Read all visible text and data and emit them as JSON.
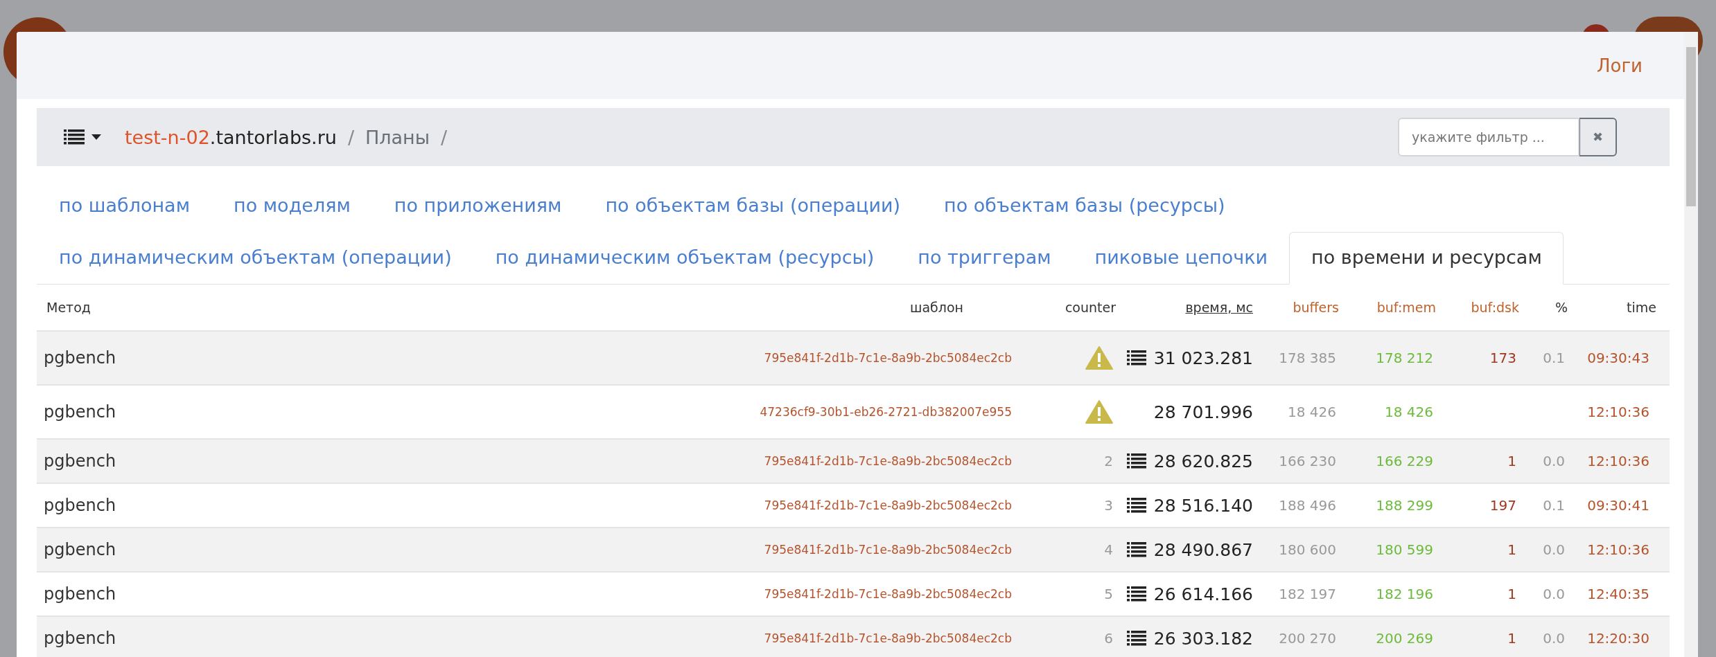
{
  "header": {
    "link": "Логи"
  },
  "breadcrumb": {
    "host_highlight": "test-n-02",
    "host_rest": ".tantorlabs.ru",
    "separator_1": "/",
    "section": "Планы",
    "separator_2": "/"
  },
  "filter": {
    "placeholder": "укажите фильтр ...",
    "clear": "✖"
  },
  "tabs": [
    [
      {
        "label": "по шаблонам",
        "selected": false
      },
      {
        "label": "по моделям",
        "selected": false
      },
      {
        "label": "по приложениям",
        "selected": false
      },
      {
        "label": "по объектам базы (операции)",
        "selected": false
      },
      {
        "label": "по объектам базы (ресурсы)",
        "selected": false
      }
    ],
    [
      {
        "label": "по динамическим объектам (операции)",
        "selected": false
      },
      {
        "label": "по динамическим объектам (ресурсы)",
        "selected": false
      },
      {
        "label": "по триггерам",
        "selected": false
      },
      {
        "label": "пиковые цепочки",
        "selected": false
      },
      {
        "label": "по времени и ресурсам",
        "selected": true
      }
    ]
  ],
  "table": {
    "columns": [
      {
        "label": "Метод",
        "kind": "plain"
      },
      {
        "label": "шаблон",
        "kind": "plain"
      },
      {
        "label": "counter",
        "kind": "plain"
      },
      {
        "label": "время, мс",
        "kind": "sort"
      },
      {
        "label": "buffers",
        "kind": "accent"
      },
      {
        "label": "buf:mem",
        "kind": "accent"
      },
      {
        "label": "buf:dsk",
        "kind": "accent"
      },
      {
        "label": "%",
        "kind": "plain"
      },
      {
        "label": "time",
        "kind": "plain"
      }
    ],
    "rows": [
      {
        "method": "pgbench",
        "template": "795e841f-2d1b-7c1e-8a9b-2bc5084ec2cb",
        "warning": true,
        "counter": "",
        "has_plan": true,
        "time_ms": "31 023.281",
        "buffers": "178 385",
        "buf_mem": "178 212",
        "buf_dsk": "173",
        "pct": "0.1",
        "time": "09:30:43"
      },
      {
        "method": "pgbench",
        "template": "47236cf9-30b1-eb26-2721-db382007e955",
        "warning": true,
        "counter": "",
        "has_plan": false,
        "time_ms": "28 701.996",
        "buffers": "18 426",
        "buf_mem": "18 426",
        "buf_dsk": "",
        "pct": "",
        "time": "12:10:36"
      },
      {
        "method": "pgbench",
        "template": "795e841f-2d1b-7c1e-8a9b-2bc5084ec2cb",
        "warning": false,
        "counter": "2",
        "has_plan": true,
        "time_ms": "28 620.825",
        "buffers": "166 230",
        "buf_mem": "166 229",
        "buf_dsk": "1",
        "pct": "0.0",
        "time": "12:10:36"
      },
      {
        "method": "pgbench",
        "template": "795e841f-2d1b-7c1e-8a9b-2bc5084ec2cb",
        "warning": false,
        "counter": "3",
        "has_plan": true,
        "time_ms": "28 516.140",
        "buffers": "188 496",
        "buf_mem": "188 299",
        "buf_dsk": "197",
        "pct": "0.1",
        "time": "09:30:41"
      },
      {
        "method": "pgbench",
        "template": "795e841f-2d1b-7c1e-8a9b-2bc5084ec2cb",
        "warning": false,
        "counter": "4",
        "has_plan": true,
        "time_ms": "28 490.867",
        "buffers": "180 600",
        "buf_mem": "180 599",
        "buf_dsk": "1",
        "pct": "0.0",
        "time": "12:10:36"
      },
      {
        "method": "pgbench",
        "template": "795e841f-2d1b-7c1e-8a9b-2bc5084ec2cb",
        "warning": false,
        "counter": "5",
        "has_plan": true,
        "time_ms": "26 614.166",
        "buffers": "182 197",
        "buf_mem": "182 196",
        "buf_dsk": "1",
        "pct": "0.0",
        "time": "12:40:35"
      },
      {
        "method": "pgbench",
        "template": "795e841f-2d1b-7c1e-8a9b-2bc5084ec2cb",
        "warning": false,
        "counter": "6",
        "has_plan": true,
        "time_ms": "26 303.182",
        "buffers": "200 270",
        "buf_mem": "200 269",
        "buf_dsk": "1",
        "pct": "0.0",
        "time": "12:20:30"
      }
    ]
  }
}
